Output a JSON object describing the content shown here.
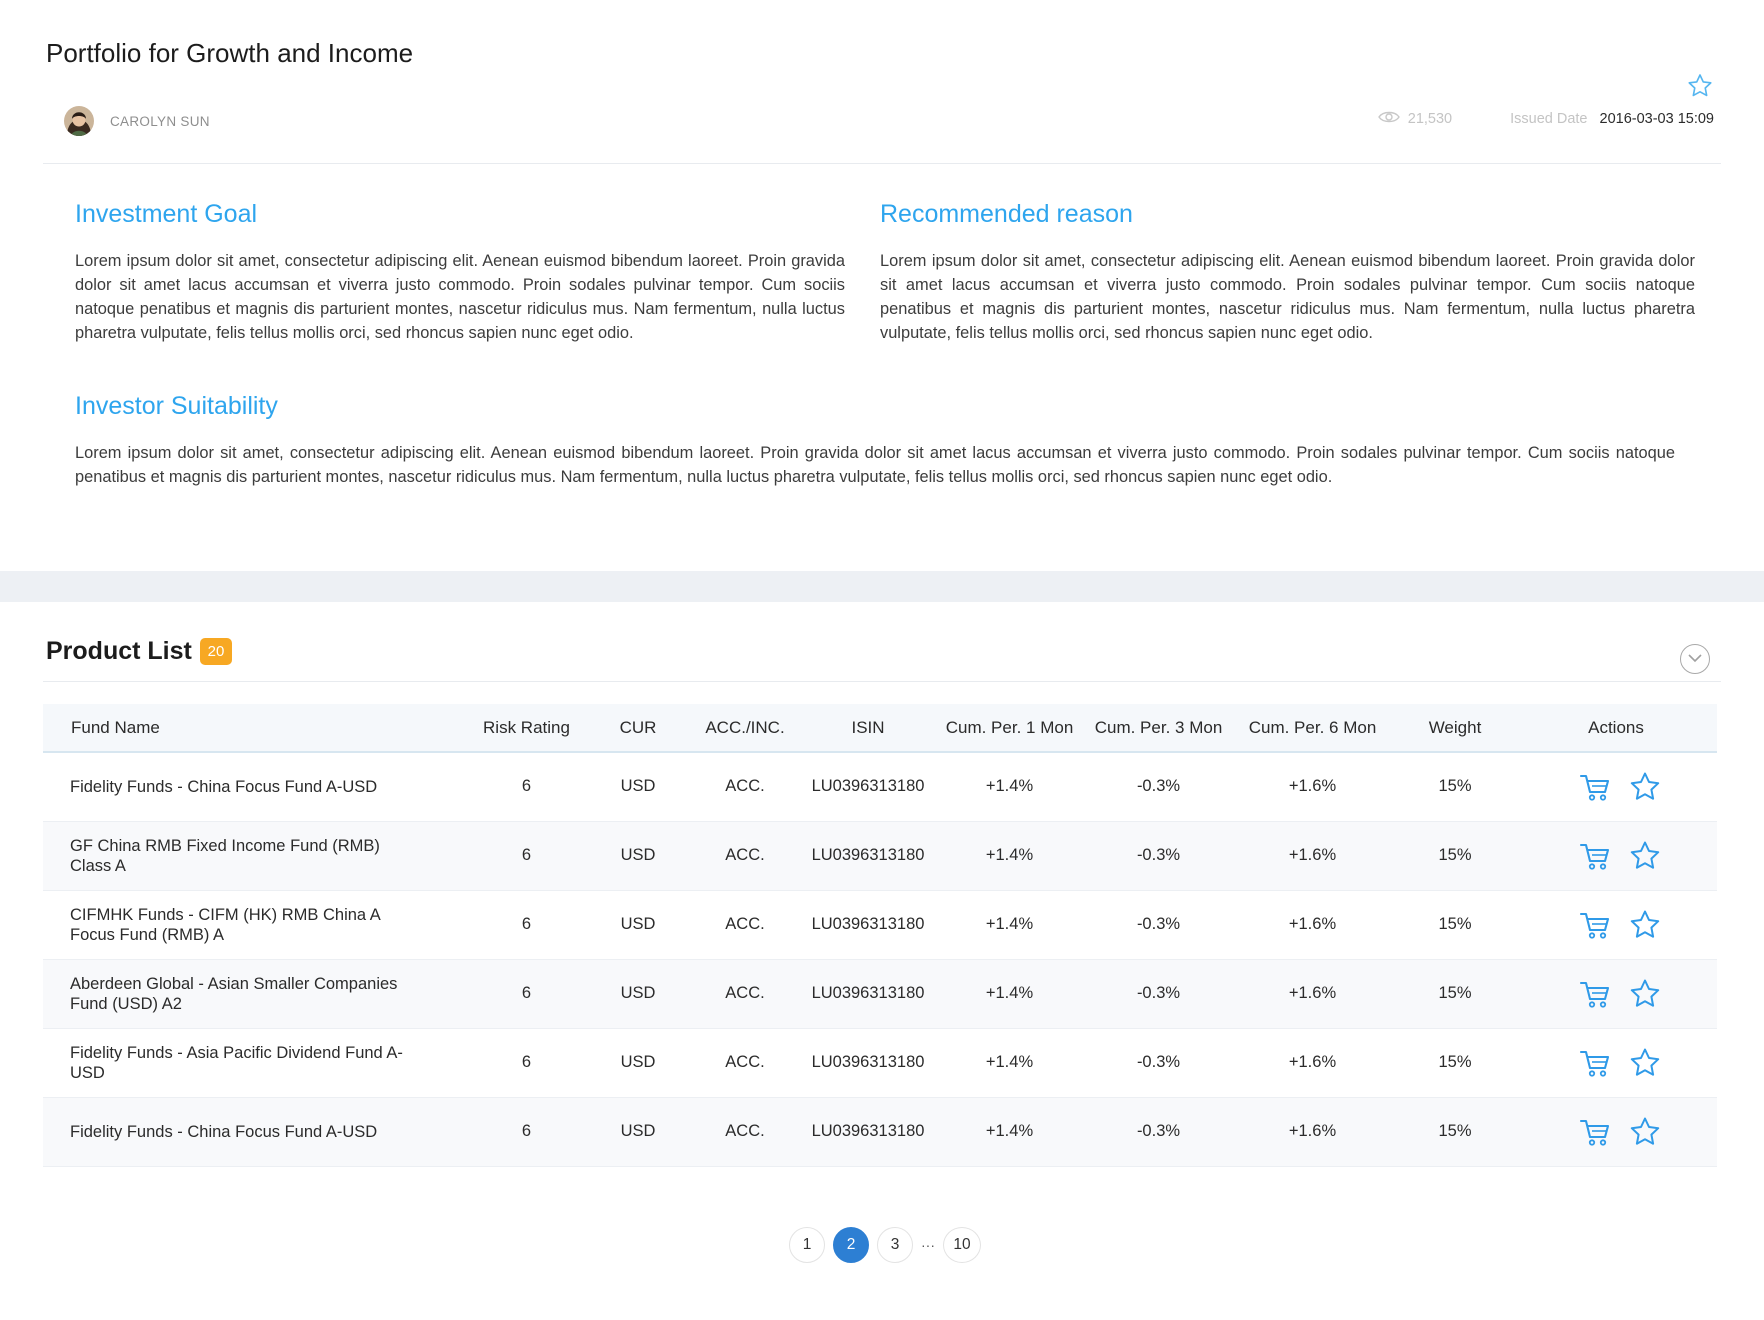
{
  "header": {
    "title": "Portfolio for Growth and Income",
    "author": "CAROLYN SUN",
    "views": "21,530",
    "issued_label": "Issued Date",
    "issued_date": "2016-03-03 15:09"
  },
  "sections": {
    "investment_goal": {
      "heading": "Investment Goal",
      "text": "Lorem ipsum dolor sit amet, consectetur adipiscing elit. Aenean euismod bibendum laoreet. Proin gravida dolor sit amet lacus accumsan et viverra justo commodo. Proin sodales pulvinar tempor. Cum sociis natoque penatibus et magnis dis parturient montes, nascetur ridiculus mus. Nam fermentum, nulla luctus pharetra vulputate, felis tellus mollis orci, sed rhoncus sapien nunc eget odio."
    },
    "recommended_reason": {
      "heading": "Recommended reason",
      "text": "Lorem ipsum dolor sit amet, consectetur adipiscing elit. Aenean euismod bibendum laoreet. Proin gravida dolor sit amet lacus accumsan et viverra justo commodo. Proin sodales pulvinar tempor. Cum sociis natoque penatibus et magnis dis parturient montes, nascetur ridiculus mus. Nam fermentum, nulla luctus pharetra vulputate, felis tellus mollis orci, sed rhoncus sapien nunc eget odio."
    },
    "investor_suitability": {
      "heading": "Investor Suitability",
      "text": "Lorem ipsum dolor sit amet, consectetur adipiscing elit. Aenean euismod bibendum laoreet. Proin gravida dolor sit amet lacus accumsan et viverra justo commodo. Proin sodales pulvinar tempor. Cum sociis natoque penatibus et magnis dis parturient montes, nascetur ridiculus mus. Nam fermentum, nulla luctus pharetra vulputate, felis tellus mollis orci, sed rhoncus sapien nunc eget odio."
    }
  },
  "product_list": {
    "title": "Product List",
    "count": "20",
    "columns": [
      "Fund Name",
      "Risk Rating",
      "CUR",
      "ACC./INC.",
      "ISIN",
      "Cum. Per. 1 Mon",
      "Cum. Per. 3 Mon",
      "Cum. Per. 6 Mon",
      "Weight",
      "Actions"
    ],
    "rows": [
      {
        "name": "Fidelity Funds - China Focus Fund A-USD",
        "risk": "6",
        "cur": "USD",
        "acc": "ACC.",
        "isin": "LU0396313180",
        "p1": "+1.4%",
        "p3": "-0.3%",
        "p6": "+1.6%",
        "weight": "15%"
      },
      {
        "name": "GF China RMB Fixed Income Fund (RMB) Class A",
        "risk": "6",
        "cur": "USD",
        "acc": "ACC.",
        "isin": "LU0396313180",
        "p1": "+1.4%",
        "p3": "-0.3%",
        "p6": "+1.6%",
        "weight": "15%"
      },
      {
        "name": "CIFMHK Funds - CIFM (HK) RMB China A Focus Fund (RMB) A",
        "risk": "6",
        "cur": "USD",
        "acc": "ACC.",
        "isin": "LU0396313180",
        "p1": "+1.4%",
        "p3": "-0.3%",
        "p6": "+1.6%",
        "weight": "15%"
      },
      {
        "name": "Aberdeen Global - Asian Smaller Companies Fund (USD) A2",
        "risk": "6",
        "cur": "USD",
        "acc": "ACC.",
        "isin": "LU0396313180",
        "p1": "+1.4%",
        "p3": "-0.3%",
        "p6": "+1.6%",
        "weight": "15%"
      },
      {
        "name": "Fidelity Funds - Asia Pacific Dividend Fund A-USD",
        "risk": "6",
        "cur": "USD",
        "acc": "ACC.",
        "isin": "LU0396313180",
        "p1": "+1.4%",
        "p3": "-0.3%",
        "p6": "+1.6%",
        "weight": "15%"
      },
      {
        "name": "Fidelity Funds - China Focus Fund A-USD",
        "risk": "6",
        "cur": "USD",
        "acc": "ACC.",
        "isin": "LU0396313180",
        "p1": "+1.4%",
        "p3": "-0.3%",
        "p6": "+1.6%",
        "weight": "15%"
      }
    ]
  },
  "pagination": {
    "pages": [
      "1",
      "2",
      "3"
    ],
    "current": "2",
    "ellipsis": "···",
    "last": "10"
  },
  "icons": {
    "favorite": "star-icon",
    "cart": "cart-icon",
    "views": "eye-icon",
    "collapse": "chevron-down-icon"
  },
  "colors": {
    "accent": "#2ea5ee",
    "positive": "#36a637",
    "negative": "#e8412e",
    "badge": "#f7a823",
    "pager_active": "#2d7fd3"
  }
}
